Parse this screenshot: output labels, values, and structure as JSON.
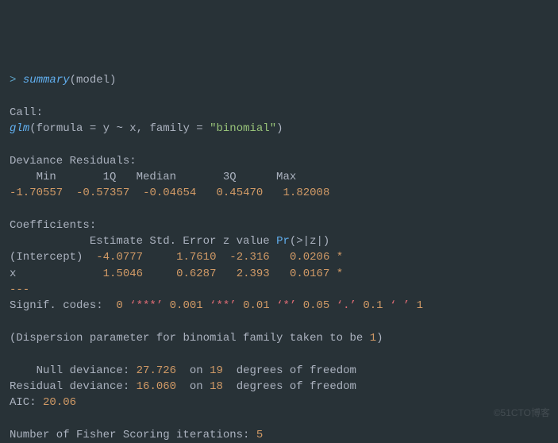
{
  "prompt": {
    "symbol": "> ",
    "func": "summary",
    "open": "(",
    "arg": "model",
    "close": ")"
  },
  "call": {
    "label": "Call:",
    "func": "glm",
    "open": "(",
    "formula_kw": "formula = ",
    "formula": "y ~ x",
    "sep1": ", ",
    "family_kw": "family = ",
    "quote1": "\"",
    "family_val": "binomial",
    "quote2": "\"",
    "close": ")"
  },
  "dev_res": {
    "header": "Deviance Residuals: ",
    "cols": "    Min       1Q   Median       3Q      Max  ",
    "vals": [
      "-1.70557",
      "-0.57357",
      "-0.04654",
      "0.45470",
      "1.82008"
    ]
  },
  "coef": {
    "header": "Coefficients:",
    "cols_pre": "            Estimate Std. Error z value ",
    "cols_pr": "Pr",
    "cols_post": "(>|z|)  ",
    "rows": [
      {
        "name": "(Intercept)",
        "est": "-4.0777",
        "se": "1.7610",
        "z": "-2.316",
        "p": "0.0206",
        "sig": "*"
      },
      {
        "name": "x          ",
        "est": " 1.5046",
        "se": "0.6287",
        "z": " 2.393",
        "p": "0.0167",
        "sig": "*"
      }
    ],
    "dashes": "---"
  },
  "signif": {
    "label": "Signif. codes:  ",
    "n0": "0",
    "c0": " ‘***’ ",
    "n1": "0.001",
    "c1": " ‘**’ ",
    "n2": "0.01",
    "c2": " ‘*’ ",
    "n3": "0.05",
    "c3": " ‘.’ ",
    "n4": "0.1",
    "c4": " ‘ ’ ",
    "n5": "1"
  },
  "dispersion": {
    "open": "(",
    "text": "Dispersion parameter for binomial family taken to be ",
    "val": "1",
    "close": ")"
  },
  "deviance": {
    "null_label": "    Null deviance: ",
    "null_val": "27.726",
    "on1": "  on ",
    "null_df": "19",
    "dof1": "  degrees of freedom",
    "resid_label": "Residual deviance: ",
    "resid_val": "16.060",
    "on2": "  on ",
    "resid_df": "18",
    "dof2": "  degrees of freedom",
    "aic_label": "AIC: ",
    "aic_val": "20.06"
  },
  "fisher": {
    "label": "Number of Fisher Scoring iterations: ",
    "val": "5"
  },
  "watermark": "©51CTO博客"
}
